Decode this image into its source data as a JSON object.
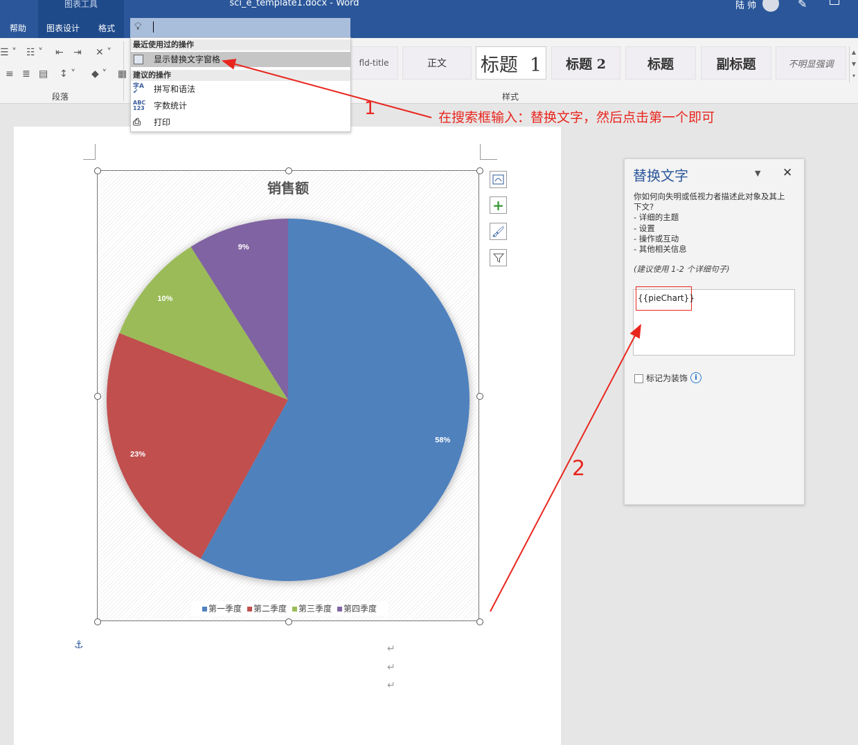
{
  "window": {
    "title": "sci_e_template1.docx  -  Word",
    "context_group": "图表工具",
    "user": "陆 帅"
  },
  "ribbon": {
    "tabs": [
      "帮助",
      "图表设计",
      "格式"
    ],
    "groups": {
      "paragraph": "段落",
      "styles": "样式"
    },
    "styles": [
      "fld-title",
      "正文",
      "标题  1",
      "标题 2",
      "标题",
      "副标题",
      "不明显强调"
    ]
  },
  "search": {
    "value": "",
    "recent_header": "最近使用过的操作",
    "recent_items": [
      {
        "label": "显示替换文字窗格",
        "icon": "alt-text-icon"
      }
    ],
    "suggested_header": "建议的操作",
    "suggested_items": [
      {
        "label": "拼写和语法",
        "icon": "spelling-icon"
      },
      {
        "label": "字数统计",
        "icon": "word-count-icon"
      },
      {
        "label": "打印",
        "icon": "print-icon"
      }
    ]
  },
  "chart_data": {
    "type": "pie",
    "title": "销售额",
    "categories": [
      "第一季度",
      "第二季度",
      "第三季度",
      "第四季度"
    ],
    "values": [
      58,
      23,
      10,
      9
    ],
    "labels": [
      "58%",
      "23%",
      "10%",
      "9%"
    ],
    "colors": [
      "#4f81bd",
      "#c0504d",
      "#9bbb59",
      "#8064a2"
    ],
    "legend_position": "bottom"
  },
  "alt_text_pane": {
    "title": "替换文字",
    "desc_lines": [
      "你如何向失明或低视力者描述此对象及其上",
      "下文?",
      "- 详细的主题",
      "- 设置",
      "- 操作或互动",
      "- 其他相关信息"
    ],
    "hint": "(建议使用 1-2 个详细句子)",
    "input_value": "{{pieChart}}",
    "decorative_label": "标记为装饰",
    "decorative_checked": false
  },
  "annotations": {
    "step1_number": "1",
    "step1_text": "在搜索框输入：替换文字，然后点击第一个即可",
    "step2_number": "2"
  },
  "colors": {
    "titlebar": "#2b579a",
    "annotation": "#e8261e",
    "pane_title": "#2b579a"
  }
}
